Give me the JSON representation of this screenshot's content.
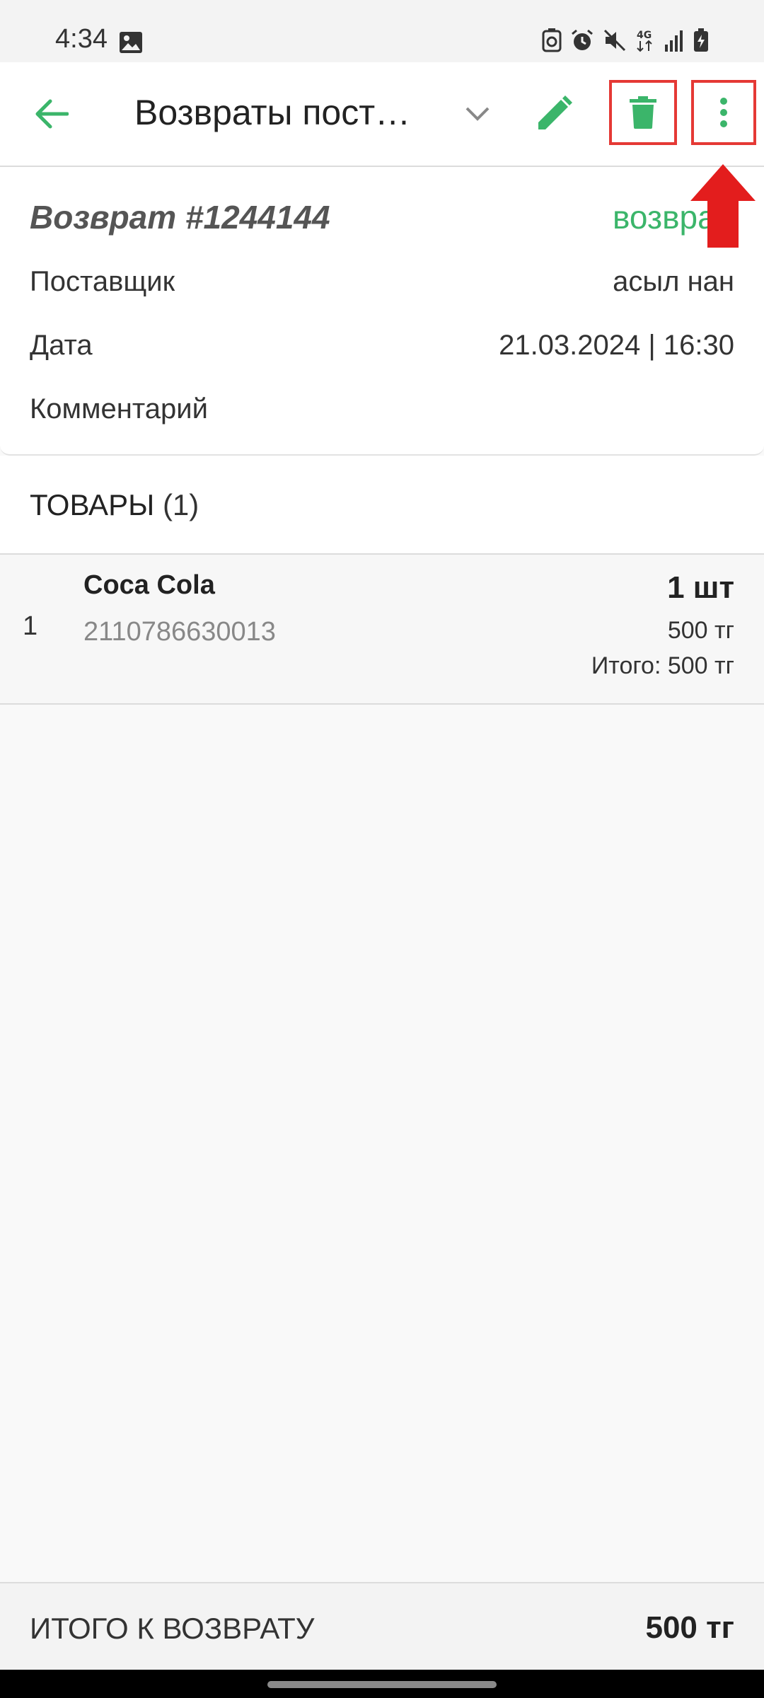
{
  "status_bar": {
    "time": "4:34",
    "icons": [
      "gallery-icon",
      "recycle-icon",
      "alarm-icon",
      "mute-icon",
      "4g-icon",
      "signal-icon",
      "battery-icon"
    ]
  },
  "app_bar": {
    "title": "Возвраты пост…",
    "actions": [
      "back-icon",
      "chevron-down-icon",
      "edit-icon",
      "delete-icon",
      "more-vert-icon"
    ]
  },
  "return_info": {
    "title": "Возврат #1244144",
    "status": "возвра",
    "supplier_label": "Поставщик",
    "supplier_value": "асыл нан",
    "date_label": "Дата",
    "date_value": "21.03.2024 | 16:30",
    "comment_label": "Комментарий"
  },
  "products": {
    "header": "ТОВАРЫ",
    "count": "(1)",
    "items": [
      {
        "index": "1",
        "name": "Coca Cola",
        "barcode": "2110786630013",
        "quantity": "1 шт",
        "price": "500 тг",
        "total": "Итого: 500 тг"
      }
    ]
  },
  "footer": {
    "total_label": "ИТОГО К ВОЗВРАТУ",
    "total_value": "500 тг"
  },
  "colors": {
    "accent": "#3bb56a",
    "annotation": "#e53935"
  }
}
